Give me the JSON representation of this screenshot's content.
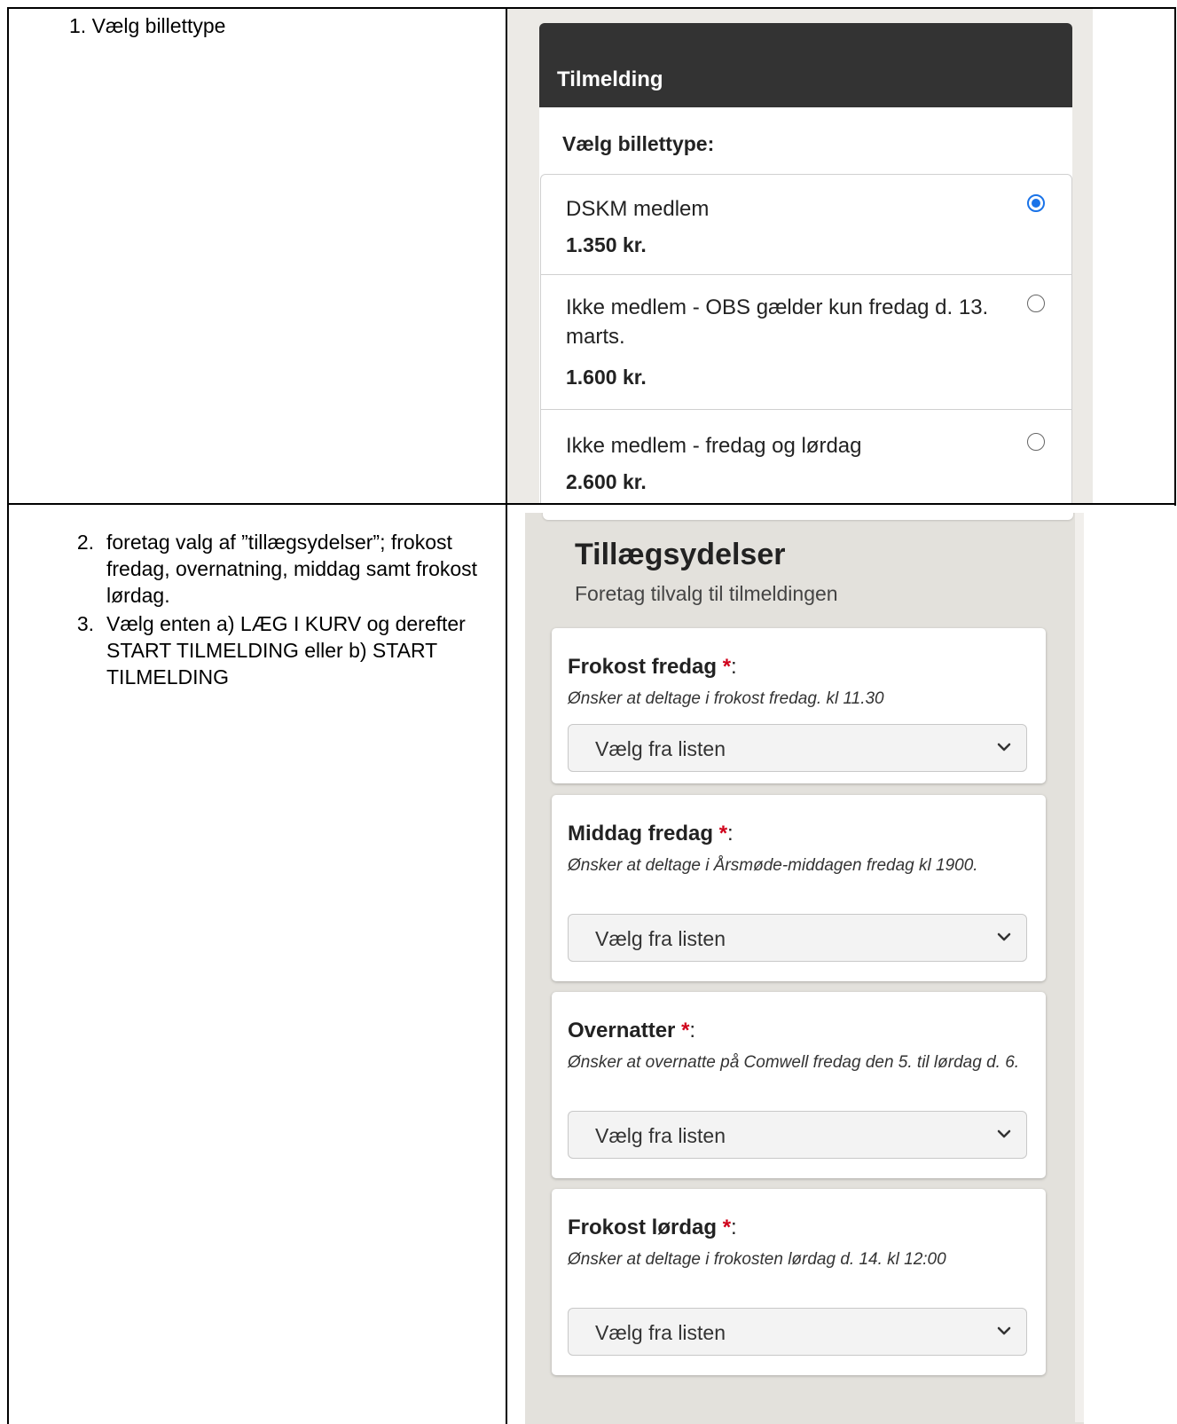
{
  "left_column": {
    "step1": "1. Vælg billettype",
    "steps": [
      {
        "num": "2.",
        "text": "foretag valg af ”tillægsydelser”; frokost fredag, overnatning, middag samt frokost lørdag."
      },
      {
        "num": "3.",
        "text": "Vælg enten a) LÆG I KURV og derefter START TILMELDING eller b) START TILMELDING"
      }
    ]
  },
  "registration": {
    "header": "Tilmelding",
    "choose_label": "Vælg billettype:",
    "tickets": [
      {
        "name": "DSKM medlem",
        "price": "1.350 kr.",
        "selected": true
      },
      {
        "name": "Ikke medlem - OBS gælder kun fredag d. 13. marts.",
        "price": "1.600 kr.",
        "selected": false
      },
      {
        "name": "Ikke medlem - fredag og lørdag",
        "price": "2.600 kr.",
        "selected": false
      }
    ]
  },
  "addons": {
    "title": "Tillægsydelser",
    "subtitle": "Foretag tilvalg til tilmeldingen",
    "cards": [
      {
        "title": "Frokost fredag",
        "required_mark": "*",
        "colon": ":",
        "description": "Ønsker at deltage i frokost fredag. kl 11.30",
        "select_value": "Vælg fra listen"
      },
      {
        "title": "Middag fredag",
        "required_mark": "*",
        "colon": ":",
        "description": "Ønsker at deltage i Årsmøde-middagen fredag kl 1900.",
        "select_value": "Vælg fra listen"
      },
      {
        "title": "Overnatter",
        "required_mark": "*",
        "colon": ":",
        "description": "Ønsker at overnatte på Comwell fredag den 5. til lørdag d. 6.",
        "select_value": "Vælg fra listen"
      },
      {
        "title": "Frokost lørdag",
        "required_mark": "*",
        "colon": ":",
        "description": "Ønsker at deltage i frokosten lørdag d. 14. kl 12:00",
        "select_value": "Vælg fra listen"
      }
    ]
  },
  "colors": {
    "header_bg": "#333333",
    "radio_selected": "#1a73e8",
    "required": "#d0021b"
  }
}
